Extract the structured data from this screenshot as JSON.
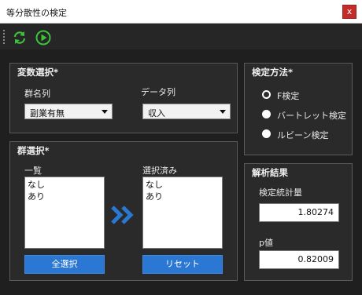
{
  "window": {
    "title": "等分散性の検定",
    "close_label": "x"
  },
  "toolbar": {
    "refresh_color": "#3cc43c",
    "run_color": "#3cc43c"
  },
  "variables": {
    "title": "変数選択*",
    "group_label": "群名列",
    "group_value": "副業有無",
    "data_label": "データ列",
    "data_value": "収入"
  },
  "groups": {
    "title": "群選択*",
    "list_label": "一覧",
    "list_items": [
      "なし",
      "あり"
    ],
    "selected_label": "選択済み",
    "selected_items": [
      "なし",
      "あり"
    ],
    "select_all_label": "全選択",
    "reset_label": "リセット",
    "accent_color": "#2a78d4"
  },
  "method": {
    "title": "検定方法*",
    "options": [
      {
        "label": "F検定",
        "checked": true
      },
      {
        "label": "バートレット検定",
        "checked": false
      },
      {
        "label": "ルビーン検定",
        "checked": false
      }
    ]
  },
  "results": {
    "title": "解析結果",
    "stat_label": "検定統計量",
    "stat_value": "1.80274",
    "p_label": "p値",
    "p_value": "0.82009"
  }
}
